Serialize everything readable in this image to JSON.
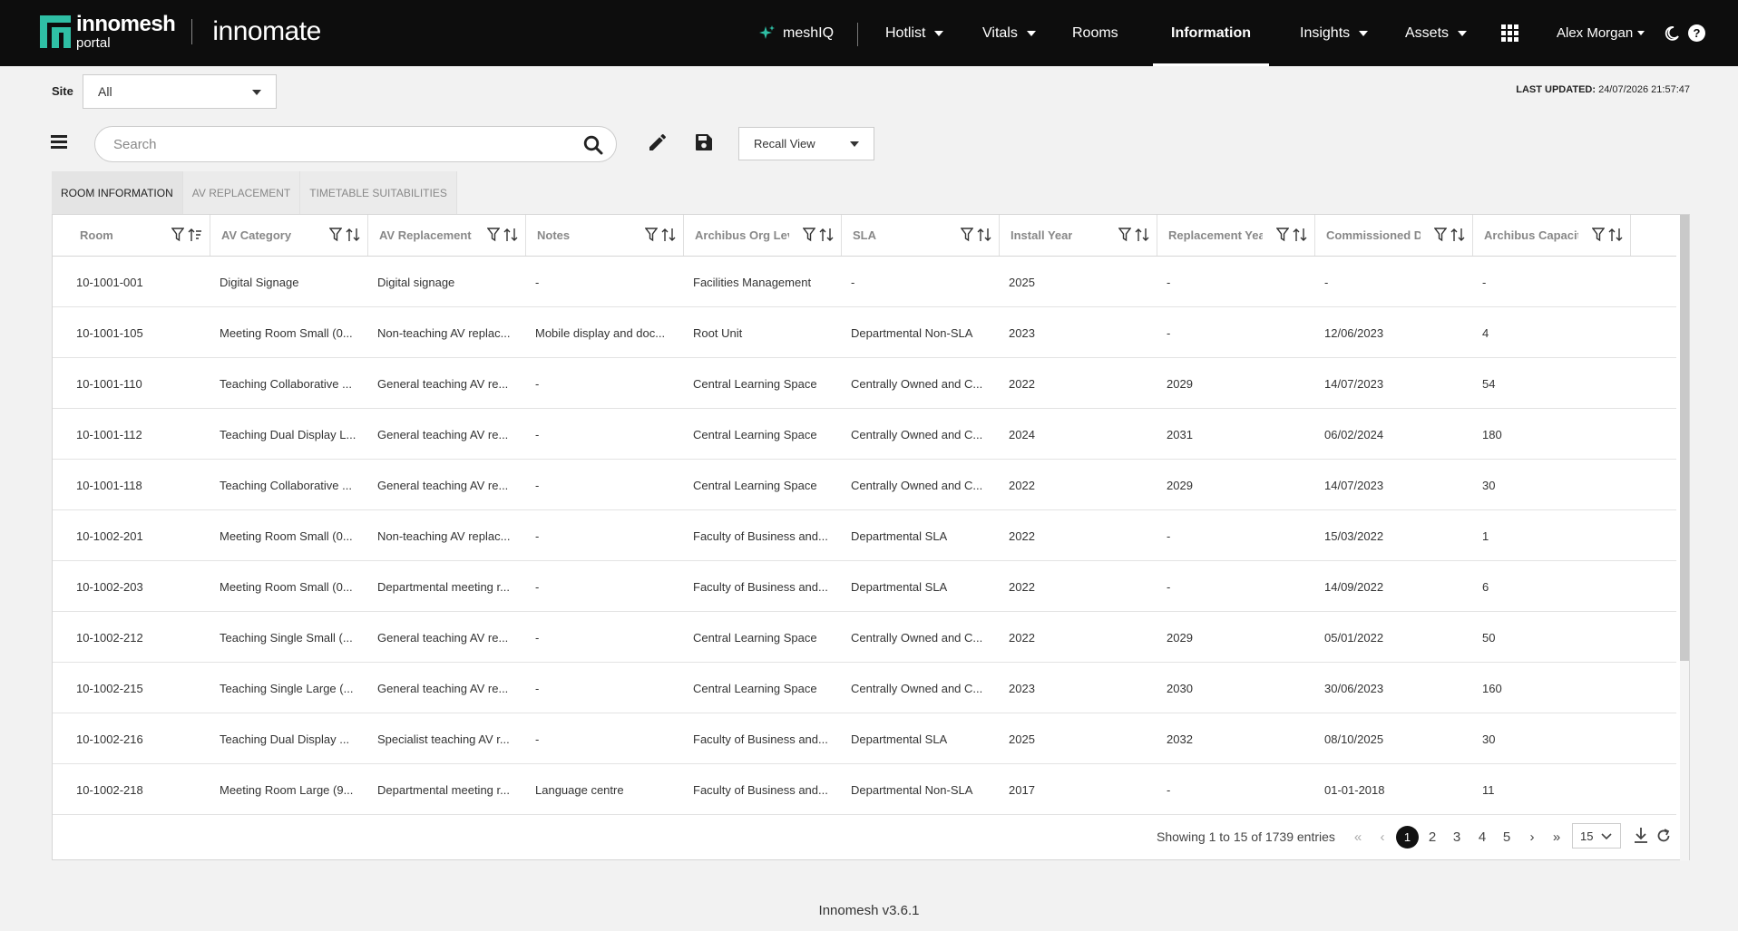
{
  "brand": {
    "logo_top": "innomesh",
    "logo_bottom": "portal",
    "product": "innomate"
  },
  "nav": {
    "meshiq": "meshIQ",
    "hotlist": "Hotlist",
    "vitals": "Vitals",
    "rooms": "Rooms",
    "information": "Information",
    "insights": "Insights",
    "assets": "Assets",
    "user": "Alex Morgan"
  },
  "filters": {
    "site_label": "Site",
    "site_value": "All",
    "last_updated_label": "LAST UPDATED:",
    "last_updated_value": " 24/07/2026 21:57:47"
  },
  "toolbar": {
    "search_placeholder": "Search",
    "recall_view": "Recall View"
  },
  "tabs": [
    "ROOM INFORMATION",
    "AV REPLACEMENT",
    "TIMETABLE SUITABILITIES"
  ],
  "table": {
    "columns": [
      "Room",
      "AV Category",
      "AV Replacement Cl",
      "Notes",
      "Archibus Org Level",
      "SLA",
      "Install Year",
      "Replacement Year",
      "Commissioned Date",
      "Archibus Capacity c"
    ],
    "rows": [
      [
        "10-1001-001",
        "Digital Signage",
        "Digital signage",
        "-",
        "Facilities Management",
        "-",
        "2025",
        "-",
        "-",
        "-"
      ],
      [
        "10-1001-105",
        "Meeting Room Small (0...",
        "Non-teaching AV replac...",
        "Mobile display and doc...",
        "Root Unit",
        "Departmental Non-SLA",
        "2023",
        "-",
        "12/06/2023",
        "4"
      ],
      [
        "10-1001-110",
        "Teaching Collaborative ...",
        "General teaching AV re...",
        "-",
        "Central Learning Space",
        "Centrally Owned and C...",
        "2022",
        "2029",
        "14/07/2023",
        "54"
      ],
      [
        "10-1001-112",
        "Teaching Dual Display L...",
        "General teaching AV re...",
        "-",
        "Central Learning Space",
        "Centrally Owned and C...",
        "2024",
        "2031",
        "06/02/2024",
        "180"
      ],
      [
        "10-1001-118",
        "Teaching Collaborative ...",
        "General teaching AV re...",
        "-",
        "Central Learning Space",
        "Centrally Owned and C...",
        "2022",
        "2029",
        "14/07/2023",
        "30"
      ],
      [
        "10-1002-201",
        "Meeting Room Small (0...",
        "Non-teaching AV replac...",
        "-",
        "Faculty of Business and...",
        "Departmental SLA",
        "2022",
        "-",
        "15/03/2022",
        "1"
      ],
      [
        "10-1002-203",
        "Meeting Room Small (0...",
        "Departmental meeting r...",
        "-",
        "Faculty of Business and...",
        "Departmental SLA",
        "2022",
        "-",
        "14/09/2022",
        "6"
      ],
      [
        "10-1002-212",
        "Teaching Single Small (...",
        "General teaching AV re...",
        "-",
        "Central Learning Space",
        "Centrally Owned and C...",
        "2022",
        "2029",
        "05/01/2022",
        "50"
      ],
      [
        "10-1002-215",
        "Teaching Single Large (...",
        "General teaching AV re...",
        "-",
        "Central Learning Space",
        "Centrally Owned and C...",
        "2023",
        "2030",
        "30/06/2023",
        "160"
      ],
      [
        "10-1002-216",
        "Teaching Dual Display ...",
        "Specialist teaching AV r...",
        "-",
        "Faculty of Business and...",
        "Departmental SLA",
        "2025",
        "2032",
        "08/10/2025",
        "30"
      ],
      [
        "10-1002-218",
        "Meeting Room Large (9...",
        "Departmental meeting r...",
        "Language centre",
        "Faculty of Business and...",
        "Departmental Non-SLA",
        "2017",
        "-",
        "01-01-2018",
        "11"
      ]
    ]
  },
  "pagination": {
    "summary": "Showing 1 to 15 of 1739 entries",
    "pages": [
      "1",
      "2",
      "3",
      "4",
      "5"
    ],
    "page_size": "15"
  },
  "footer": "Innomesh v3.6.1",
  "colors": {
    "header_bg": "#0d0d0d",
    "accent": "#2fbfa5"
  }
}
